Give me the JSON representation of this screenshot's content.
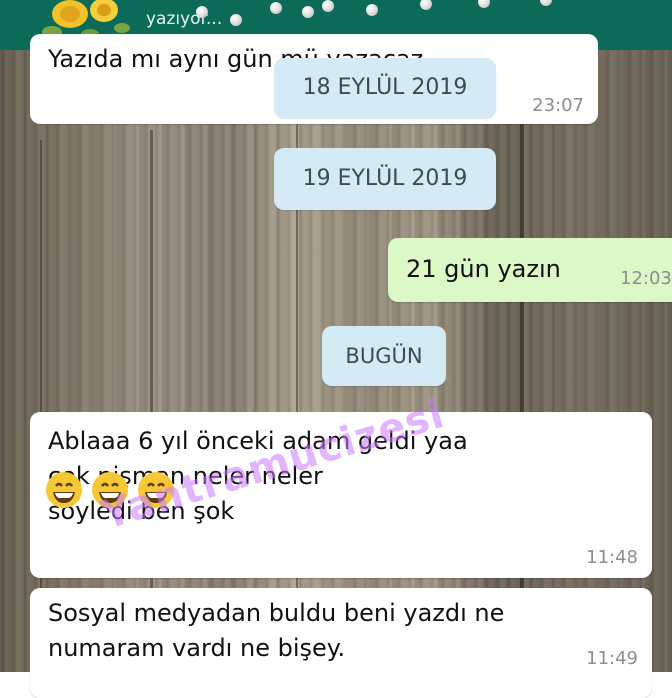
{
  "header": {
    "status": "yazıyor..."
  },
  "messages": [
    {
      "direction": "in",
      "text": "Yazıda mı aynı gün mü yazacaz",
      "time": "23:07"
    },
    {
      "direction": "out",
      "text": "21 gün yazın",
      "time": "12:03"
    },
    {
      "direction": "in",
      "text": "Ablaaa 6 yıl önceki adam geldi yaa\n     çok pişman neler neler\nsöyledi ben şok",
      "time": "11:48"
    },
    {
      "direction": "in",
      "text": "Sosyal medyadan buldu beni yazdı ne\nnumaram vardı ne bişey.",
      "time": "11:49"
    }
  ],
  "date_separators": [
    "18 EYLÜL 2019",
    "19 EYLÜL 2019",
    "BUGÜN"
  ],
  "emoji": [
    "grinning-face",
    "grinning-face",
    "grinning-face"
  ],
  "watermark": "Yantramucizesi",
  "colors": {
    "header": "#0b6b58",
    "incoming_bubble": "#ffffff",
    "outgoing_bubble": "#dcf8c6",
    "date_chip": "#d4eaf4",
    "watermark": "#cd78ff"
  }
}
